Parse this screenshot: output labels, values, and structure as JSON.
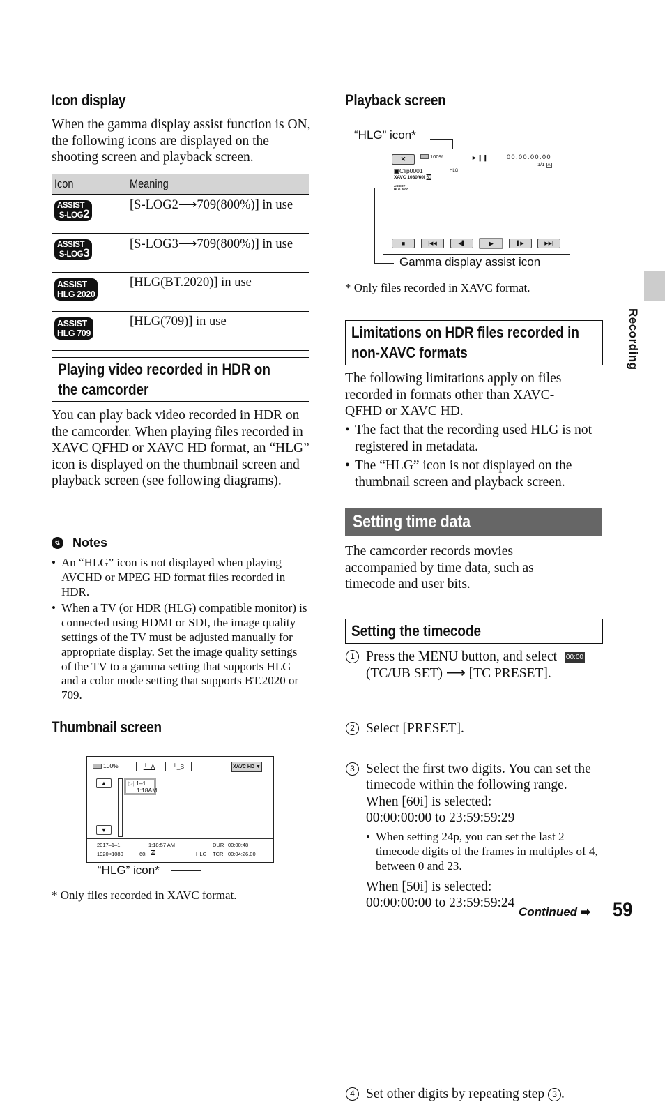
{
  "page": {
    "number": "59",
    "continued": "Continued",
    "side_tab": "Recording"
  },
  "icon_display": {
    "heading": "Icon display",
    "intro": "When the gamma display assist function is ON, the following icons are displayed on the shooting screen and playback screen.",
    "table": {
      "headers": [
        "Icon",
        "Meaning"
      ],
      "rows": [
        {
          "icon_top": "ASSIST",
          "icon_bottom": "S-LOG",
          "icon_num": "2",
          "meaning": "[S-LOG2⟶709(800%)] in use"
        },
        {
          "icon_top": "ASSIST",
          "icon_bottom": "S-LOG",
          "icon_num": "3",
          "meaning": "[S-LOG3⟶709(800%)] in use"
        },
        {
          "icon_top": "ASSIST",
          "icon_bottom": "HLG 2020",
          "icon_num": "",
          "meaning": "[HLG(BT.2020)] in use"
        },
        {
          "icon_top": "ASSIST",
          "icon_bottom": "HLG 709",
          "icon_num": "",
          "meaning": "[HLG(709)] in use"
        }
      ]
    }
  },
  "playing_hdr": {
    "heading_line1": "Playing video recorded in HDR on",
    "heading_line2": "the camcorder",
    "body": "You can play back video recorded in HDR on the camcorder. When playing files recorded in XAVC QFHD or XAVC HD format, an “HLG” icon is displayed on the thumbnail screen and playback screen (see following diagrams).",
    "notes_title": "Notes",
    "notes": [
      "An “HLG” icon is not displayed when playing AVCHD or MPEG HD format files recorded in HDR.",
      "When a TV (or HDR (HLG) compatible monitor) is connected using HDMI or SDI, the image quality settings of the TV must be adjusted manually for appropriate display. Set the image quality settings of the TV to a gamma setting that supports HLG and a color mode setting that supports BT.2020 or 709."
    ]
  },
  "thumbnail_screen": {
    "heading": "Thumbnail screen",
    "battery": "100%",
    "tab_a": "A",
    "tab_b": "B",
    "format_select": "XAVC HD",
    "thumb_clip": "1–1",
    "thumb_time": "1:18AM",
    "date": "2017–1–1",
    "time": "1:18:57 AM",
    "dur_label": "DUR",
    "dur_value": "00:00:48",
    "resolution": "1920×1080",
    "frame_rate": "60i",
    "rate_badge": "50",
    "hlg": "HLG",
    "tcr_label": "TCR",
    "tcr_value": "00:04:26.00",
    "callout": "“HLG” icon*",
    "footnote": "* Only files recorded in XAVC format."
  },
  "playback_screen": {
    "heading": "Playback screen",
    "callout_hlg": "“HLG” icon*",
    "callout_gamma": "Gamma display assist icon",
    "battery": "100%",
    "play_pause": "►❙❙",
    "timecode": "00:00:00.00",
    "counter": "1/1",
    "hlg": "HLG",
    "clip": "Clip0001",
    "format": "XAVC 1080/60i",
    "rate_badge": "50",
    "assist_mini_top": "ASSIST",
    "assist_mini_bottom": "HLG 2020",
    "controls": [
      "stop",
      "previous",
      "frame-back",
      "play",
      "frame-forward",
      "next"
    ],
    "footnote": "* Only files recorded in XAVC format."
  },
  "limitations": {
    "heading_line1": "Limitations on HDR files recorded in",
    "heading_line2": "non-XAVC formats",
    "body": "The following limitations apply on files recorded in formats other than XAVC-QFHD or XAVC HD.",
    "bullets": [
      "The fact that the recording used HLG is not registered in metadata.",
      "The “HLG” icon is not displayed on the thumbnail screen and playback screen."
    ]
  },
  "time_data": {
    "heading": "Setting time data",
    "body": "The camcorder records movies accompanied by time data, such as timecode and user bits.",
    "sub_heading": "Setting the timecode",
    "menu_icon": "00:00",
    "steps": [
      {
        "num": "1",
        "text_a": "Press the MENU button, and select",
        "text_b": "(TC/UB SET) ⟶ [TC PRESET]."
      },
      {
        "num": "2",
        "text": "Select [PRESET]."
      },
      {
        "num": "3",
        "text": "Select the first two digits. You can set the timecode within the following range.",
        "range_60_label": "When [60i] is selected:",
        "range_60": "00:00:00:00 to 23:59:59:29",
        "note": "When setting 24p, you can set the last 2 timecode digits of the frames in multiples of 4, between 0 and 23.",
        "range_50_label": "When [50i] is selected:",
        "range_50": "00:00:00:00 to 23:59:59:24"
      },
      {
        "num": "4",
        "text": "Set other digits by repeating step",
        "ref": "3"
      }
    ]
  }
}
